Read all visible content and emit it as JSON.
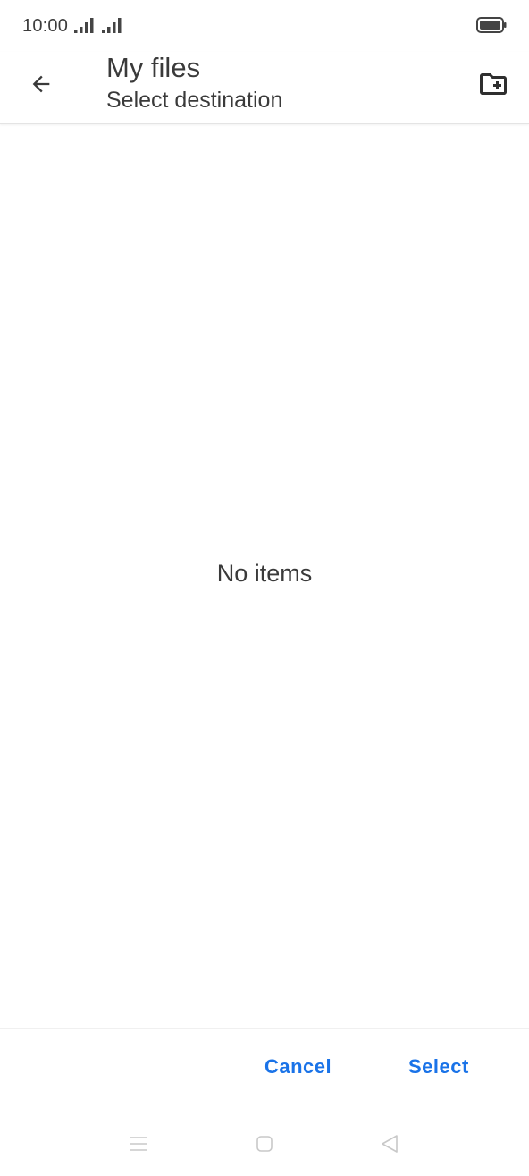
{
  "status_bar": {
    "time": "10:00"
  },
  "app_bar": {
    "title": "My files",
    "subtitle": "Select destination",
    "back_icon": "arrow-back-icon",
    "new_folder_icon": "create-new-folder-icon"
  },
  "content": {
    "empty_message": "No items"
  },
  "actions": {
    "cancel_label": "Cancel",
    "select_label": "Select"
  },
  "colors": {
    "accent": "#1a73e8",
    "text_primary": "#3a3a3a",
    "background": "#ffffff",
    "nav_icon": "#c8c8c8"
  }
}
